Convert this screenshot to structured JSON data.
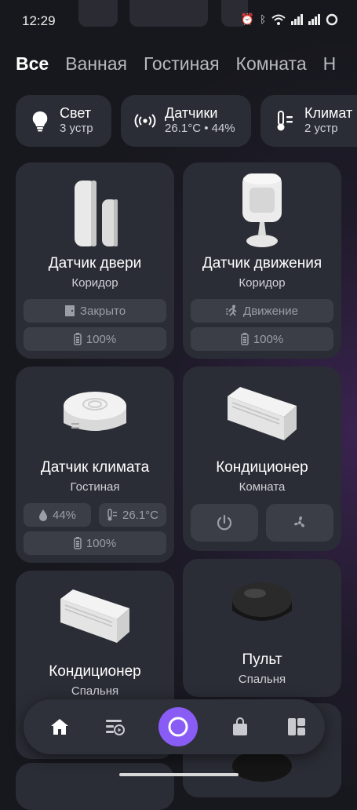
{
  "status_bar": {
    "time": "12:29",
    "network": "4G"
  },
  "tabs": [
    {
      "label": "Все",
      "active": true
    },
    {
      "label": "Ванная",
      "active": false
    },
    {
      "label": "Гостиная",
      "active": false
    },
    {
      "label": "Комната",
      "active": false
    },
    {
      "label": "Н",
      "active": false
    }
  ],
  "chips": [
    {
      "icon": "bulb-icon",
      "title": "Свет",
      "subtitle": "3 устр"
    },
    {
      "icon": "sensor-waves-icon",
      "title": "Датчики",
      "subtitle": "26.1°C • 44%"
    },
    {
      "icon": "thermometer-icon",
      "title": "Климат",
      "subtitle": "2 устр"
    }
  ],
  "cards": {
    "door_sensor": {
      "name": "Датчик двери",
      "room": "Коридор",
      "state": "Закрыто",
      "battery": "100%"
    },
    "motion_sensor": {
      "name": "Датчик движения",
      "room": "Коридор",
      "state": "Движение",
      "battery": "100%"
    },
    "climate_sensor": {
      "name": "Датчик климата",
      "room": "Гостиная",
      "humidity": "44%",
      "temperature": "26.1°C",
      "battery": "100%"
    },
    "ac_room": {
      "name": "Кондиционер",
      "room": "Комната"
    },
    "ac_bedroom": {
      "name": "Кондиционер",
      "room": "Спальня"
    },
    "remote": {
      "name": "Пульт",
      "room": "Спальня"
    }
  },
  "bottom_nav": [
    "home-icon",
    "scenarios-icon",
    "alice-icon",
    "shop-icon",
    "dashboard-icon"
  ],
  "colors": {
    "background": "#17181d",
    "card": "#2b2d36",
    "pill": "#3b3d47",
    "alice": "#8a5cf6"
  }
}
